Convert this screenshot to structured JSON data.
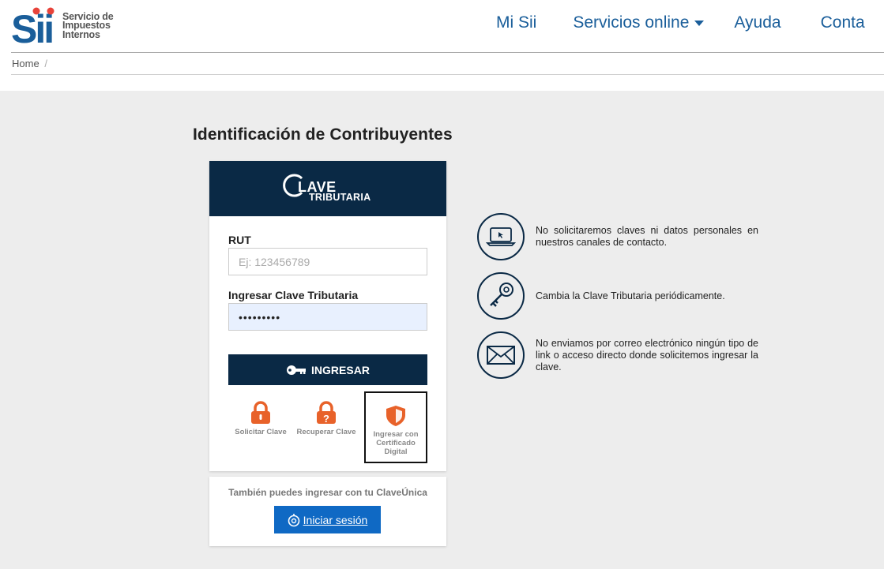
{
  "header": {
    "logo_mark": "sii",
    "logo_lines": [
      "Servicio de",
      "Impuestos",
      "Internos"
    ],
    "nav": [
      "Mi Sii",
      "Servicios online",
      "Ayuda",
      "Conta"
    ]
  },
  "breadcrumb": {
    "home": "Home",
    "separator": "/"
  },
  "page_title": "Identificación de Contribuyentes",
  "login": {
    "brand_word": "LAVE",
    "brand_sub": "TRIBUTARIA",
    "rut_label": "RUT",
    "rut_placeholder": "Ej: 123456789",
    "clave_label": "Ingresar Clave Tributaria",
    "clave_value": "•••••••••",
    "submit_label": "INGRESAR",
    "options": {
      "solicitar": "Solicitar Clave",
      "recuperar": "Recuperar Clave",
      "certificado": "Ingresar con Certificado Digital"
    }
  },
  "claveunica": {
    "text": "También puedes ingresar con tu ClaveÚnica",
    "button": "Iniciar sesión"
  },
  "tips": [
    {
      "icon": "laptop-icon",
      "text": "No solicitaremos claves ni datos personales en nuestros canales de contacto."
    },
    {
      "icon": "key-icon",
      "text": "Cambia la Clave Tributaria periódicamente."
    },
    {
      "icon": "envelope-icon",
      "text": "No enviamos por correo electrónico ningún tipo de link o acceso directo donde solicitemos ingresar la clave."
    }
  ],
  "colors": {
    "navy": "#0a2945",
    "link_blue": "#1a5e9a",
    "accent_orange": "#e8622a",
    "button_blue": "#0f69c4",
    "background": "#ededed"
  }
}
